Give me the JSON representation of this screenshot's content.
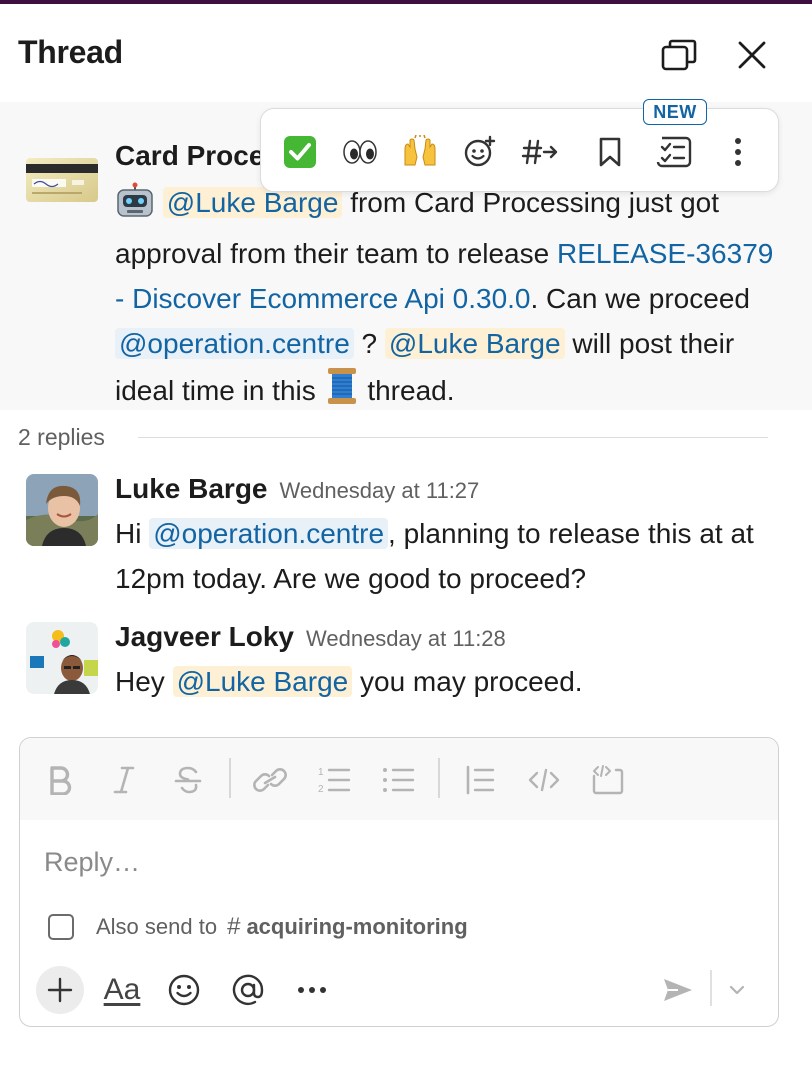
{
  "header": {
    "title": "Thread"
  },
  "parent_message": {
    "sender": "Card Proce",
    "mention_1": "@Luke Barge",
    "text_1": " from Card Processing just got approval from their team to release ",
    "release_link": "RELEASE-36379 - Discover Ecommerce Api 0.30.0",
    "text_2": ". Can we proceed ",
    "mention_2": "@operation.centre",
    "text_3": " ? ",
    "mention_3": "@Luke Barge",
    "text_4": " will post their ideal time in this ",
    "text_5": " thread."
  },
  "hover_toolbar": {
    "new_badge": "NEW",
    "items": [
      "white-check-mark-emoji",
      "eyes-emoji",
      "raised-hands-emoji",
      "add-reaction-icon",
      "forward-to-channel-icon",
      "bookmark-icon",
      "create-list-icon",
      "more-actions-icon"
    ]
  },
  "replies": {
    "count_label": "2 replies",
    "items": [
      {
        "name": "Luke Barge",
        "time": "Wednesday at 11:27",
        "text_1": "Hi ",
        "mention": "@operation.centre",
        "text_2": ", planning to release this at at 12pm today. Are we good to proceed?"
      },
      {
        "name": "Jagveer Loky",
        "time": "Wednesday at 11:28",
        "text_1": "Hey ",
        "mention": "@Luke Barge",
        "text_2": " you may proceed."
      }
    ]
  },
  "composer": {
    "placeholder": "Reply…",
    "also_send_label": "Also send to",
    "channel_hash": "#",
    "channel_name": "acquiring-monitoring",
    "aa_label": "Aa"
  },
  "colors": {
    "brand_purple": "#3f0e40",
    "link_blue": "#1264a3",
    "mention_bg": "#fdf0d5"
  }
}
